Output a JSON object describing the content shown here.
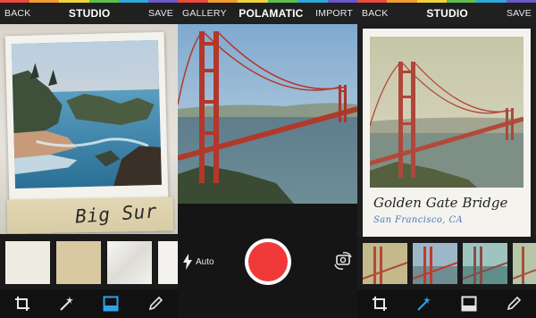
{
  "colors": {
    "rainbow": [
      "#e84b3c",
      "#f39c32",
      "#f1d33a",
      "#5fbf4e",
      "#2fa7d8",
      "#6b58c9"
    ],
    "shutter": "#f03a3a",
    "accent_blue": "#2aa4e8"
  },
  "left": {
    "back": "BACK",
    "title": "STUDIO",
    "save": "SAVE",
    "caption": "Big Sur",
    "thumbnails": [
      "plain-paper",
      "tan-paper",
      "white-crumpled-paper",
      "white-paper"
    ],
    "tools": [
      "crop-icon",
      "magic-wand-icon",
      "frame-icon",
      "pen-icon"
    ],
    "selected_tool": "frame-icon"
  },
  "middle": {
    "gallery": "GALLERY",
    "title": "POLAMATIC",
    "import": "IMPORT",
    "flash_label": "Auto"
  },
  "right": {
    "back": "BACK",
    "title": "STUDIO",
    "save": "SAVE",
    "caption_title": "Golden Gate Bridge",
    "caption_subtitle": "San Francisco, CA",
    "filters": [
      "filter-warm",
      "filter-vivid",
      "filter-cool",
      "filter-faded"
    ],
    "tools": [
      "crop-icon",
      "magic-wand-icon",
      "frame-icon",
      "pen-icon"
    ],
    "selected_tool": "magic-wand-icon"
  }
}
